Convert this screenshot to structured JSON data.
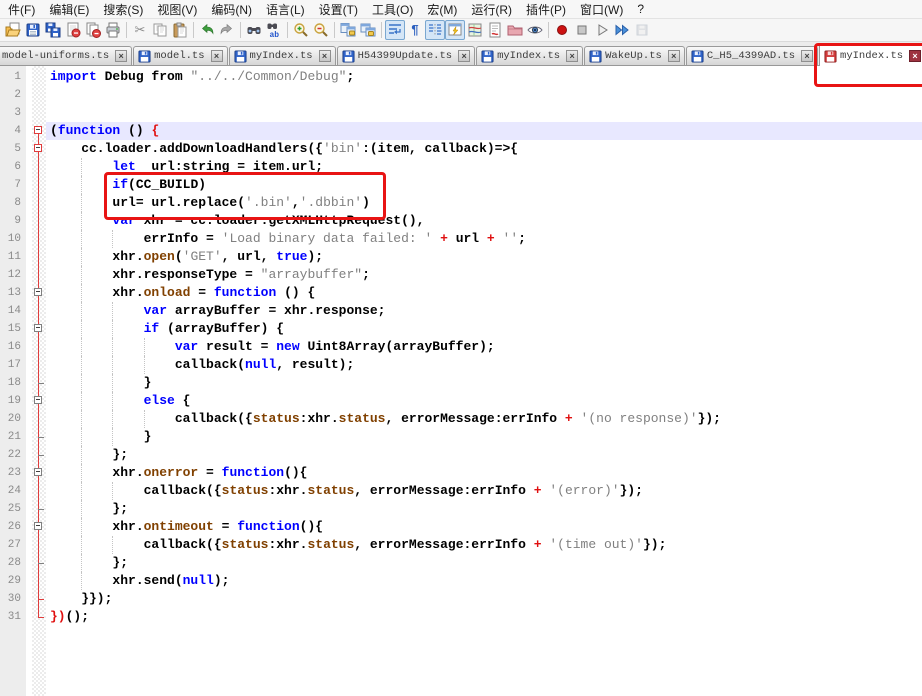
{
  "menu": {
    "items": [
      "件(F)",
      "编辑(E)",
      "搜索(S)",
      "视图(V)",
      "编码(N)",
      "语言(L)",
      "设置(T)",
      "工具(O)",
      "宏(M)",
      "运行(R)",
      "插件(P)",
      "窗口(W)",
      "?"
    ]
  },
  "toolbar": {
    "items": [
      {
        "name": "open-file"
      },
      {
        "name": "save"
      },
      {
        "name": "save-all"
      },
      {
        "name": "close"
      },
      {
        "name": "close-all"
      },
      {
        "name": "print"
      },
      {
        "sep": true
      },
      {
        "name": "cut"
      },
      {
        "name": "copy"
      },
      {
        "name": "paste"
      },
      {
        "sep": true
      },
      {
        "name": "undo"
      },
      {
        "name": "redo"
      },
      {
        "sep": true
      },
      {
        "name": "find"
      },
      {
        "name": "replace"
      },
      {
        "sep": true
      },
      {
        "name": "zoom-in"
      },
      {
        "name": "zoom-out"
      },
      {
        "sep": true
      },
      {
        "name": "sync-vertical"
      },
      {
        "name": "sync-horizontal"
      },
      {
        "sep": true
      },
      {
        "name": "word-wrap",
        "pressed": true
      },
      {
        "name": "show-all-chars"
      },
      {
        "name": "indent-guide",
        "pressed": true
      },
      {
        "name": "user-dialog",
        "pressed": true
      },
      {
        "name": "doc-map"
      },
      {
        "name": "function-list"
      },
      {
        "name": "folder-workspace"
      },
      {
        "name": "monitor"
      },
      {
        "sep": true
      },
      {
        "name": "macro-record"
      },
      {
        "name": "macro-stop"
      },
      {
        "name": "macro-play"
      },
      {
        "name": "macro-run-multi"
      },
      {
        "name": "macro-save",
        "disabled": true
      }
    ]
  },
  "tabs": [
    {
      "label": "model-uniforms.ts",
      "state": "saved",
      "no_icon": true,
      "first": true
    },
    {
      "label": "model.ts",
      "state": "saved"
    },
    {
      "label": "myIndex.ts",
      "state": "saved"
    },
    {
      "label": "H54399Update.ts",
      "state": "saved"
    },
    {
      "label": "myIndex.ts",
      "state": "saved"
    },
    {
      "label": "WakeUp.ts",
      "state": "saved"
    },
    {
      "label": "C_H5_4399AD.ts",
      "state": "saved"
    },
    {
      "label": "myIndex.ts",
      "state": "modified",
      "active": true,
      "annotated": true
    }
  ],
  "editor": {
    "current_line": 4,
    "lines": [
      {
        "n": 1,
        "fold": "",
        "segs": [
          [
            "k",
            "import"
          ],
          [
            "d",
            " Debug from "
          ],
          [
            "s",
            "\"../../Common/Debug\""
          ],
          [
            "d",
            ";"
          ]
        ]
      },
      {
        "n": 2,
        "fold": "",
        "segs": []
      },
      {
        "n": 3,
        "fold": "",
        "segs": []
      },
      {
        "n": 4,
        "fold": "S",
        "segs": [
          [
            "d",
            "("
          ],
          [
            "k",
            "function"
          ],
          [
            "d",
            " () "
          ],
          [
            "r",
            "{"
          ]
        ]
      },
      {
        "n": 5,
        "fold": "B",
        "segs": [
          [
            "d",
            "    cc.loader.addDownloadHandlers({"
          ],
          [
            "s",
            "'bin'"
          ],
          [
            "d",
            ":(item, callback)=>{"
          ]
        ]
      },
      {
        "n": 6,
        "fold": "l",
        "segs": [
          [
            "d",
            "        "
          ],
          [
            "k",
            "let"
          ],
          [
            "d",
            "  url:string = item.url;"
          ]
        ]
      },
      {
        "n": 7,
        "fold": "l",
        "segs": [
          [
            "d",
            "        "
          ],
          [
            "k",
            "if"
          ],
          [
            "d",
            "(CC_BUILD)"
          ]
        ]
      },
      {
        "n": 8,
        "fold": "l",
        "segs": [
          [
            "d",
            "        url= url.replace("
          ],
          [
            "s",
            "'.bin'"
          ],
          [
            "d",
            ","
          ],
          [
            "s",
            "'.dbbin'"
          ],
          [
            "d",
            ")"
          ]
        ]
      },
      {
        "n": 9,
        "fold": "l",
        "segs": [
          [
            "d",
            "        "
          ],
          [
            "k",
            "var"
          ],
          [
            "d",
            " xhr = cc.loader.getXMLHttpRequest(),"
          ]
        ]
      },
      {
        "n": 10,
        "fold": "l",
        "segs": [
          [
            "d",
            "            errInfo = "
          ],
          [
            "s",
            "'Load binary data failed: '"
          ],
          [
            "d",
            " "
          ],
          [
            "r",
            "+"
          ],
          [
            "d",
            " url "
          ],
          [
            "r",
            "+"
          ],
          [
            "d",
            " "
          ],
          [
            "s",
            "''"
          ],
          [
            "d",
            ";"
          ]
        ]
      },
      {
        "n": 11,
        "fold": "l",
        "segs": [
          [
            "d",
            "        xhr."
          ],
          [
            "m",
            "open"
          ],
          [
            "d",
            "("
          ],
          [
            "s",
            "'GET'"
          ],
          [
            "d",
            ", url, "
          ],
          [
            "k",
            "true"
          ],
          [
            "d",
            ");"
          ]
        ]
      },
      {
        "n": 12,
        "fold": "l",
        "segs": [
          [
            "d",
            "        xhr.responseType = "
          ],
          [
            "s",
            "\"arraybuffer\""
          ],
          [
            "d",
            ";"
          ]
        ]
      },
      {
        "n": 13,
        "fold": "b",
        "segs": [
          [
            "d",
            "        xhr."
          ],
          [
            "m",
            "onload"
          ],
          [
            "d",
            " = "
          ],
          [
            "k",
            "function"
          ],
          [
            "d",
            " () {"
          ]
        ]
      },
      {
        "n": 14,
        "fold": "l",
        "segs": [
          [
            "d",
            "            "
          ],
          [
            "k",
            "var"
          ],
          [
            "d",
            " arrayBuffer = xhr.response;"
          ]
        ]
      },
      {
        "n": 15,
        "fold": "b",
        "segs": [
          [
            "d",
            "            "
          ],
          [
            "k",
            "if"
          ],
          [
            "d",
            " (arrayBuffer) {"
          ]
        ]
      },
      {
        "n": 16,
        "fold": "l",
        "segs": [
          [
            "d",
            "                "
          ],
          [
            "k",
            "var"
          ],
          [
            "d",
            " result = "
          ],
          [
            "k",
            "new"
          ],
          [
            "d",
            " Uint8Array(arrayBuffer);"
          ]
        ]
      },
      {
        "n": 17,
        "fold": "l",
        "segs": [
          [
            "d",
            "                callback("
          ],
          [
            "k",
            "null"
          ],
          [
            "d",
            ", result);"
          ]
        ]
      },
      {
        "n": 18,
        "fold": "t",
        "segs": [
          [
            "d",
            "            }"
          ]
        ]
      },
      {
        "n": 19,
        "fold": "b",
        "segs": [
          [
            "d",
            "            "
          ],
          [
            "k",
            "else"
          ],
          [
            "d",
            " {"
          ]
        ]
      },
      {
        "n": 20,
        "fold": "l",
        "segs": [
          [
            "d",
            "                callback({"
          ],
          [
            "m",
            "status"
          ],
          [
            "d",
            ":xhr."
          ],
          [
            "m",
            "status"
          ],
          [
            "d",
            ", errorMessage:errInfo "
          ],
          [
            "r",
            "+"
          ],
          [
            "d",
            " "
          ],
          [
            "s",
            "'(no response)'"
          ],
          [
            "d",
            "});"
          ]
        ]
      },
      {
        "n": 21,
        "fold": "t",
        "segs": [
          [
            "d",
            "            }"
          ]
        ]
      },
      {
        "n": 22,
        "fold": "t",
        "segs": [
          [
            "d",
            "        };"
          ]
        ]
      },
      {
        "n": 23,
        "fold": "b",
        "segs": [
          [
            "d",
            "        xhr."
          ],
          [
            "m",
            "onerror"
          ],
          [
            "d",
            " = "
          ],
          [
            "k",
            "function"
          ],
          [
            "d",
            "(){"
          ]
        ]
      },
      {
        "n": 24,
        "fold": "l",
        "segs": [
          [
            "d",
            "            callback({"
          ],
          [
            "m",
            "status"
          ],
          [
            "d",
            ":xhr."
          ],
          [
            "m",
            "status"
          ],
          [
            "d",
            ", errorMessage:errInfo "
          ],
          [
            "r",
            "+"
          ],
          [
            "d",
            " "
          ],
          [
            "s",
            "'(error)'"
          ],
          [
            "d",
            "});"
          ]
        ]
      },
      {
        "n": 25,
        "fold": "t",
        "segs": [
          [
            "d",
            "        };"
          ]
        ]
      },
      {
        "n": 26,
        "fold": "b",
        "segs": [
          [
            "d",
            "        xhr."
          ],
          [
            "m",
            "ontimeout"
          ],
          [
            "d",
            " = "
          ],
          [
            "k",
            "function"
          ],
          [
            "d",
            "(){"
          ]
        ]
      },
      {
        "n": 27,
        "fold": "l",
        "segs": [
          [
            "d",
            "            callback({"
          ],
          [
            "m",
            "status"
          ],
          [
            "d",
            ":xhr."
          ],
          [
            "m",
            "status"
          ],
          [
            "d",
            ", errorMessage:errInfo "
          ],
          [
            "r",
            "+"
          ],
          [
            "d",
            " "
          ],
          [
            "s",
            "'(time out)'"
          ],
          [
            "d",
            "});"
          ]
        ]
      },
      {
        "n": 28,
        "fold": "t",
        "segs": [
          [
            "d",
            "        };"
          ]
        ]
      },
      {
        "n": 29,
        "fold": "l",
        "segs": [
          [
            "d",
            "        xhr.send("
          ],
          [
            "k",
            "null"
          ],
          [
            "d",
            ");"
          ]
        ]
      },
      {
        "n": 30,
        "fold": "T",
        "segs": [
          [
            "d",
            "    }});"
          ]
        ]
      },
      {
        "n": 31,
        "fold": "E",
        "segs": [
          [
            "r",
            "})"
          ],
          [
            "d",
            "();"
          ]
        ]
      }
    ]
  },
  "annotations": {
    "color": "#e81414",
    "tab_box": {
      "target": "active-tab"
    },
    "code_box": {
      "target": "lines-7-8"
    }
  },
  "colors": {
    "keyword": "#0000ff",
    "method": "#804000",
    "string": "#808080",
    "operator_red": "#e01010",
    "current_line_bg": "#e8e8ff",
    "active_tab_top": "#f7a234",
    "fold_highlight": "#e03c3c"
  }
}
